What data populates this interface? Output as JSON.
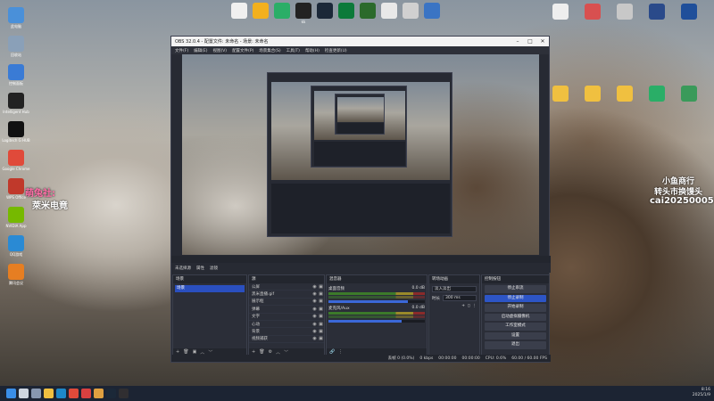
{
  "desktop_left": [
    {
      "label": "此电脑",
      "color": "#4a90d9"
    },
    {
      "label": "回收站",
      "color": "#8aa0b8"
    },
    {
      "label": "控制面板",
      "color": "#3a7bd5"
    },
    {
      "label": "Intelligent\nHub",
      "color": "#222222"
    },
    {
      "label": "Logitech G\nHUB",
      "color": "#111111"
    },
    {
      "label": "Google\nChrome",
      "color": "#e04a3a"
    },
    {
      "label": "WPS Office",
      "color": "#c0392b"
    },
    {
      "label": "NVIDIA App",
      "color": "#76b900"
    },
    {
      "label": "QQ游戏",
      "color": "#2a8ad4"
    },
    {
      "label": "腾讯会议",
      "color": "#e67e22"
    }
  ],
  "desktop_top": [
    {
      "label": "",
      "color": "#f0f0f0"
    },
    {
      "label": "",
      "color": "#f2b01e"
    },
    {
      "label": "",
      "color": "#2aae67"
    },
    {
      "label": "kk",
      "color": "#222222"
    },
    {
      "label": "",
      "color": "#1b2838"
    },
    {
      "label": "",
      "color": "#0c7a3a"
    },
    {
      "label": "",
      "color": "#2b6a2b"
    },
    {
      "label": "",
      "color": "#e8e8e8"
    },
    {
      "label": "",
      "color": "#d0d0d0"
    },
    {
      "label": "",
      "color": "#3a74c4"
    }
  ],
  "desktop_right": [
    {
      "label": "",
      "color": "#eeeeee"
    },
    {
      "label": "",
      "color": "#d85050"
    },
    {
      "label": "",
      "color": "#c8c8c8"
    },
    {
      "label": "",
      "color": "#2a4a8a"
    },
    {
      "label": "",
      "color": "#1f4f9a"
    },
    {
      "label": "",
      "color": "#f0c040"
    },
    {
      "label": "",
      "color": "#f0c040"
    },
    {
      "label": "",
      "color": "#f0c040"
    },
    {
      "label": "",
      "color": "#2aae67"
    },
    {
      "label": "",
      "color": "#3a9a5a"
    }
  ],
  "left_overlay": {
    "line1": "萌兔社:",
    "line2": "萊米电竟"
  },
  "right_overlay": {
    "line1": "小鱼商行",
    "line2": "转头市换馒头",
    "line3": "cai20250005"
  },
  "obs": {
    "title": "OBS 32.0.4 - 配置文件: 未命名 - 场景: 未命名",
    "menu": [
      "文件(F)",
      "编辑(E)",
      "视图(V)",
      "配置文件(P)",
      "场景集合(S)",
      "工具(T)",
      "帮助(H)",
      "检查更新(U)"
    ],
    "tabs": [
      "未选择源",
      "属性",
      "滤镜"
    ],
    "scenes_title": "场景",
    "scenes": [
      "场景"
    ],
    "sources_title": "源",
    "sources": [
      "公屏",
      "黑米直播.gif",
      "展示框",
      "弹幕",
      "文字",
      "心动",
      "背景",
      "视频捕获"
    ],
    "mixer_title": "混音器",
    "mixer": [
      {
        "name": "桌面音频",
        "db": "0.0 dB",
        "level": 0.82
      },
      {
        "name": "麦克风/Aux",
        "db": "0.0 dB",
        "level": 0.76
      }
    ],
    "transitions_title": "转场动画",
    "transition_value": "淡入淡出",
    "duration_label": "时长",
    "duration_value": "300 ms",
    "controls_title": "控制按钮",
    "controls": [
      {
        "label": "停止串流",
        "active": false
      },
      {
        "label": "停止录制",
        "active": true
      },
      {
        "label": "开始录制",
        "active": false
      },
      {
        "label": "启动虚拟摄像机",
        "active": false
      },
      {
        "label": "工作室模式",
        "active": false
      },
      {
        "label": "设置",
        "active": false
      },
      {
        "label": "退出",
        "active": false
      }
    ],
    "status": [
      "丢帧 0 (0.0%)",
      "0 kbps",
      "00:00:00",
      "00:00:00",
      "CPU: 0.6%",
      "60.00 / 60.00 FPS"
    ]
  },
  "tray": {
    "time": "8:16",
    "date": "2025/1/9"
  },
  "taskbar_icons": [
    {
      "name": "start",
      "color": "#3a8ee8"
    },
    {
      "name": "search",
      "color": "#cfd6e0"
    },
    {
      "name": "taskview",
      "color": "#8898b0"
    },
    {
      "name": "explorer",
      "color": "#f0c040"
    },
    {
      "name": "edge",
      "color": "#1e88c8"
    },
    {
      "name": "chrome",
      "color": "#e04a3a"
    },
    {
      "name": "app1",
      "color": "#d84040"
    },
    {
      "name": "app2",
      "color": "#e0a040"
    },
    {
      "name": "steam",
      "color": "#1b2838"
    },
    {
      "name": "obs",
      "color": "#302e31"
    }
  ]
}
